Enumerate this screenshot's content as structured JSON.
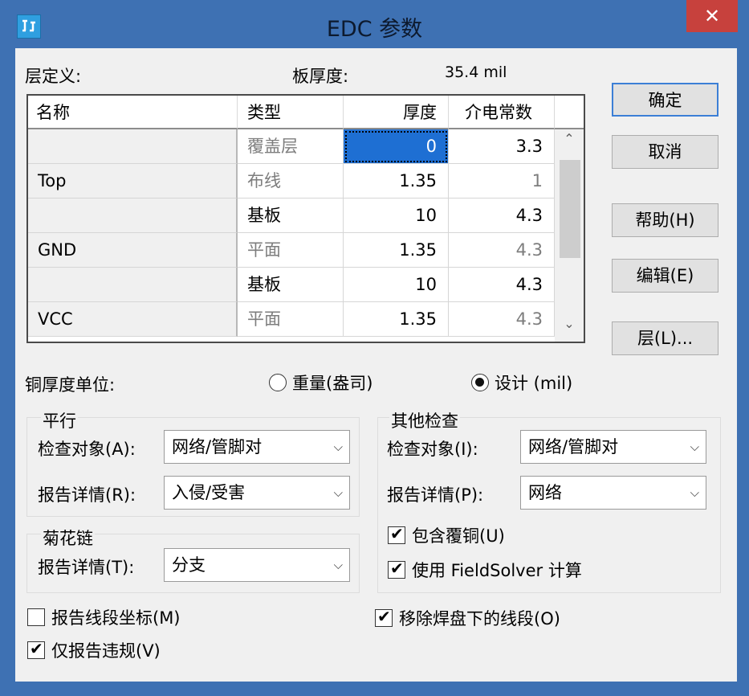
{
  "window": {
    "title": "EDC 参数",
    "close_glyph": "✕",
    "app_icon": "edc-app-icon"
  },
  "header": {
    "layer_def_label": "层定义:",
    "board_thickness_label": "板厚度:",
    "board_thickness_value": "35.4 mil"
  },
  "table": {
    "columns": [
      "名称",
      "类型",
      "厚度",
      "介电常数"
    ],
    "rows": [
      {
        "name": "",
        "type": "覆盖层",
        "thickness": "0",
        "dielectric": "3.3",
        "type_dim": true,
        "diel_dim": false
      },
      {
        "name": "Top",
        "type": "布线",
        "thickness": "1.35",
        "dielectric": "1",
        "type_dim": true,
        "diel_dim": true
      },
      {
        "name": "",
        "type": "基板",
        "thickness": "10",
        "dielectric": "4.3",
        "type_dim": false,
        "diel_dim": false
      },
      {
        "name": "GND",
        "type": "平面",
        "thickness": "1.35",
        "dielectric": "4.3",
        "type_dim": true,
        "diel_dim": true
      },
      {
        "name": "",
        "type": "基板",
        "thickness": "10",
        "dielectric": "4.3",
        "type_dim": false,
        "diel_dim": false
      },
      {
        "name": "VCC",
        "type": "平面",
        "thickness": "1.35",
        "dielectric": "4.3",
        "type_dim": true,
        "diel_dim": true
      }
    ],
    "scroll_up": "⌃",
    "scroll_down": "⌄"
  },
  "buttons": {
    "ok": "确定",
    "cancel": "取消",
    "help": "帮助(H)",
    "edit": "编辑(E)",
    "layers": "层(L)..."
  },
  "copper_unit": {
    "label": "铜厚度单位:",
    "opt_weight": "重量(盎司)",
    "opt_design": "设计 (mil)",
    "selected": "design"
  },
  "parallel": {
    "title": "平行",
    "check_obj_label": "检查对象(A):",
    "check_obj_value": "网络/管脚对",
    "report_label": "报告详情(R):",
    "report_value": "入侵/受害"
  },
  "daisy": {
    "title": "菊花链",
    "report_label": "报告详情(T):",
    "report_value": "分支"
  },
  "other": {
    "title": "其他检查",
    "check_obj_label": "检查对象(I):",
    "check_obj_value": "网络/管脚对",
    "report_label": "报告详情(P):",
    "report_value": "网络",
    "include_copper": "包含覆铜(U)",
    "use_fieldsolver": "使用 FieldSolver 计算"
  },
  "bottom": {
    "report_seg_coords": "报告线段坐标(M)",
    "report_violations_only": "仅报告违规(V)",
    "remove_pad_segments": "移除焊盘下的线段(O)"
  },
  "glyphs": {
    "check": "✔",
    "dropdown": "⌵"
  },
  "colors": {
    "titlebar": "#3e71b3",
    "close": "#c7413d",
    "selection": "#1e6fd3",
    "default_border": "#3c7fd6"
  }
}
